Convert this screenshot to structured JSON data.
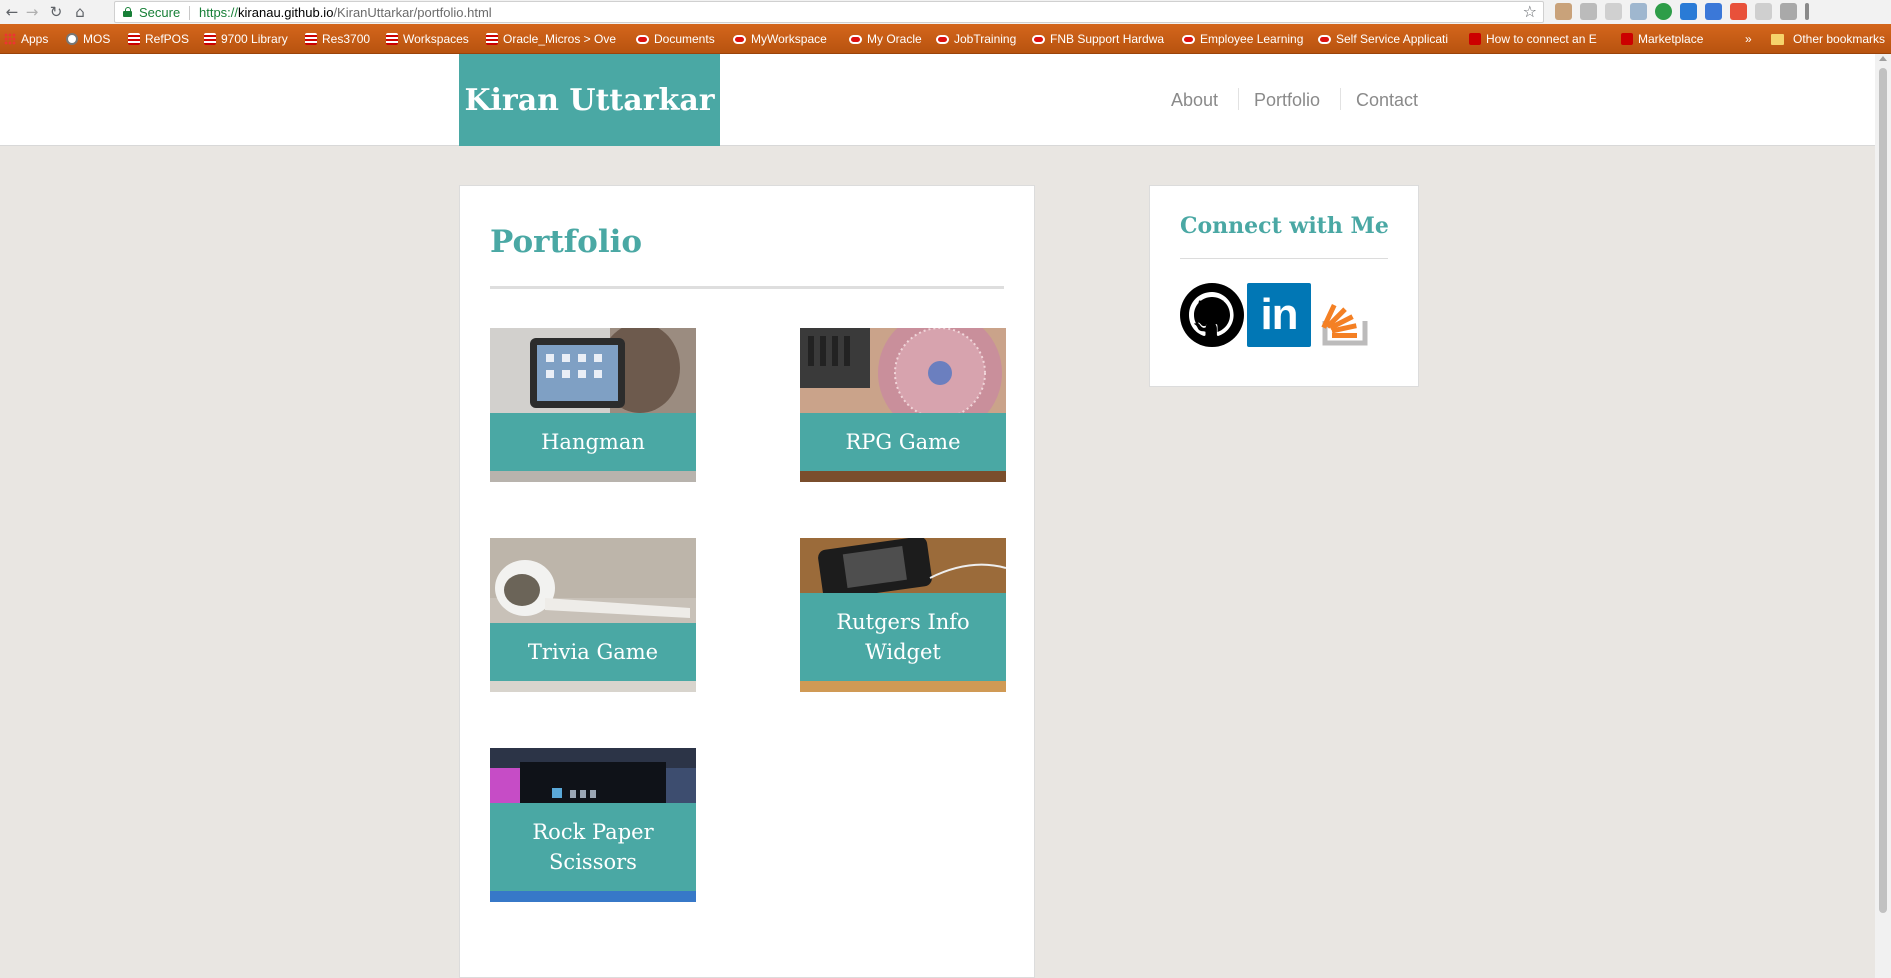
{
  "browser": {
    "secure_label": "Secure",
    "url_scheme": "https://",
    "url_host": "kiranau.github.io",
    "url_path": "/KiranUttarkar/portfolio.html",
    "bookmarks": [
      {
        "label": "Apps",
        "icon": "apps-icon"
      },
      {
        "label": "MOS",
        "icon": "globe-icon"
      },
      {
        "label": "RefPOS",
        "icon": "stack-icon"
      },
      {
        "label": "9700 Library",
        "icon": "stack-icon"
      },
      {
        "label": "Res3700",
        "icon": "stack-icon"
      },
      {
        "label": "Workspaces",
        "icon": "stack-icon"
      },
      {
        "label": "Oracle_Micros > Ove",
        "icon": "stack-icon"
      },
      {
        "label": "Documents",
        "icon": "oracle-icon"
      },
      {
        "label": "MyWorkspace",
        "icon": "oracle-icon"
      },
      {
        "label": "My Oracle",
        "icon": "oracle-icon"
      },
      {
        "label": "JobTraining",
        "icon": "oracle-icon"
      },
      {
        "label": "FNB Support Hardwa",
        "icon": "oracle-icon"
      },
      {
        "label": "Employee Learning",
        "icon": "oracle-icon"
      },
      {
        "label": "Self Service Applicati",
        "icon": "oracle-icon"
      },
      {
        "label": "How to connect an E",
        "icon": "m-icon"
      },
      {
        "label": "Marketplace",
        "icon": "bag-icon"
      }
    ],
    "overflow_label": "»",
    "other_bookmarks_label": "Other bookmarks"
  },
  "site": {
    "logo": "Kiran Uttarkar",
    "nav": [
      "About",
      "Portfolio",
      "Contact"
    ],
    "page_title": "Portfolio",
    "projects": [
      {
        "title": "Hangman",
        "image": "person-holding-tablet-photo"
      },
      {
        "title": "RPG Game",
        "image": "turntable-photo"
      },
      {
        "title": "Trivia Game",
        "image": "earbuds-photo"
      },
      {
        "title": "Rutgers Info Widget",
        "image": "phone-on-table-photo"
      },
      {
        "title": "Rock Paper Scissors",
        "image": "led-tv-photo"
      }
    ],
    "sidebar_title": "Connect with Me",
    "social": [
      {
        "name": "github-icon"
      },
      {
        "name": "linkedin-icon",
        "text": "in"
      },
      {
        "name": "stackoverflow-icon"
      }
    ]
  },
  "colors": {
    "accent": "#4aa8a4",
    "bookmarks_bar": "#c95d16",
    "page_bg": "#e9e6e2"
  }
}
